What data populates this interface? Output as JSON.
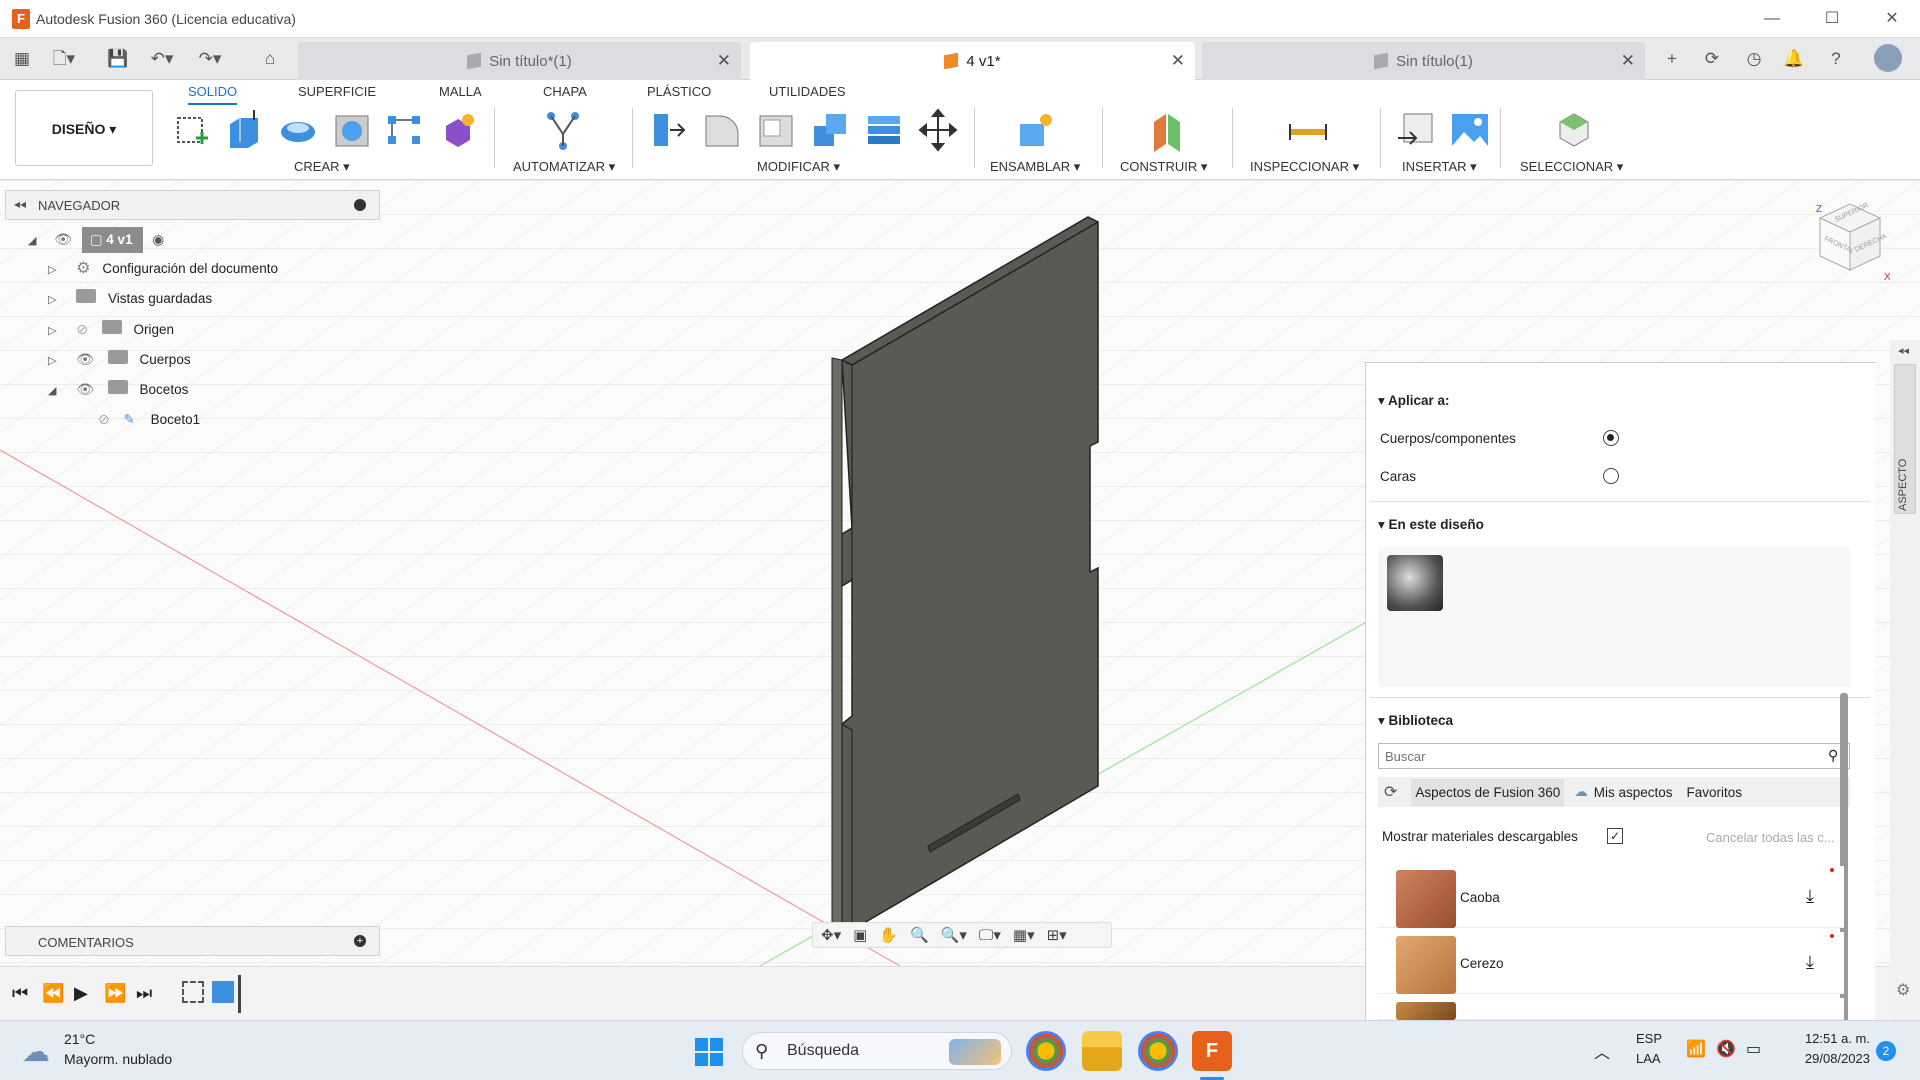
{
  "window": {
    "title": "Autodesk Fusion 360 (Licencia educativa)",
    "app_icon": "F"
  },
  "tabs": [
    {
      "label": "Sin título*(1)",
      "active": false
    },
    {
      "label": "4 v1*",
      "active": true
    },
    {
      "label": "Sin título(1)",
      "active": false
    }
  ],
  "ribbon": {
    "workspace": "DISEÑO ▾",
    "tabs": [
      "SOLIDO",
      "SUPERFICIE",
      "MALLA",
      "CHAPA",
      "PLÁSTICO",
      "UTILIDADES"
    ],
    "groups": [
      "CREAR ▾",
      "AUTOMATIZAR ▾",
      "MODIFICAR ▾",
      "ENSAMBLAR ▾",
      "CONSTRUIR ▾",
      "INSPECCIONAR ▾",
      "INSERTAR ▾",
      "SELECCIONAR ▾"
    ]
  },
  "navigator": {
    "header": "NAVEGADOR",
    "root": "4 v1",
    "items": [
      "Configuración del documento",
      "Vistas guardadas",
      "Origen",
      "Cuerpos",
      "Bocetos",
      "Boceto1"
    ]
  },
  "comments": {
    "header": "COMENTARIOS"
  },
  "viewcube": {
    "top": "SUPERIOR",
    "front": "FRONTAL",
    "right": "DERECHA",
    "z": "Z",
    "x": "X"
  },
  "appearance": {
    "side_tab": "ASPECTO",
    "apply_to": "Aplicar a:",
    "option1": "Cuerpos/componentes",
    "option2": "Caras",
    "in_design": "En este diseño",
    "library": "Biblioteca",
    "search_placeholder": "Buscar",
    "lib_tab1": "Aspectos de Fusion 360",
    "lib_tab2": "Mis aspectos",
    "lib_tab3": "Favoritos",
    "show_downloadable": "Mostrar materiales descargables",
    "cancel_all": "Cancelar todas las c...",
    "materials": [
      "Caoba",
      "Cerezo"
    ]
  },
  "taskbar": {
    "weather_temp": "21°C",
    "weather_desc": "Mayorm. nublado",
    "search": "Búsqueda",
    "lang1": "ESP",
    "lang2": "LAA",
    "time": "12:51 a. m.",
    "date": "29/08/2023",
    "notif": "2"
  }
}
